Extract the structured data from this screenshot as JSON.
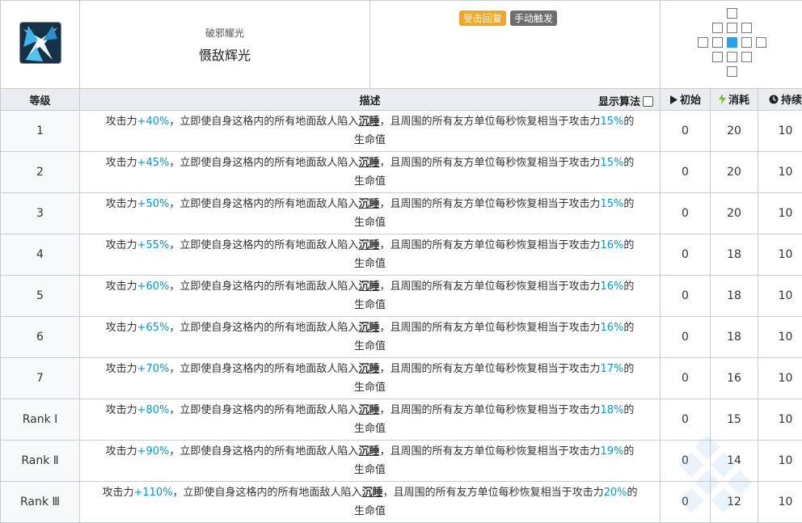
{
  "skill": {
    "sub_name": "破邪耀光",
    "name": "慑敌辉光",
    "tags": [
      "受击回复",
      "手动触发"
    ],
    "tag_colors": {
      "recovery": "#f0a722",
      "trigger": "#6e6e6e"
    },
    "icon": "skill-icon",
    "range_self_color": "#26a2e7"
  },
  "table": {
    "headers": {
      "level": "等级",
      "desc": "描述",
      "show_formula": "显示算法",
      "initial": "初始",
      "cost": "消耗",
      "duration": "持续"
    },
    "desc_parts": {
      "prefix": "攻击力",
      "mid1": "，立即使自身这格内的所有地面敌人陷入",
      "status": "沉睡",
      "mid2": "，且周围的所有友方单位每秒恢复相当于攻击力",
      "end": "的",
      "tail": "生命值"
    },
    "rows": [
      {
        "level": "1",
        "atk": "+40%",
        "heal": "15%",
        "initial": "0",
        "cost": "20",
        "duration": "10"
      },
      {
        "level": "2",
        "atk": "+45%",
        "heal": "15%",
        "initial": "0",
        "cost": "20",
        "duration": "10"
      },
      {
        "level": "3",
        "atk": "+50%",
        "heal": "15%",
        "initial": "0",
        "cost": "20",
        "duration": "10"
      },
      {
        "level": "4",
        "atk": "+55%",
        "heal": "16%",
        "initial": "0",
        "cost": "18",
        "duration": "10"
      },
      {
        "level": "5",
        "atk": "+60%",
        "heal": "16%",
        "initial": "0",
        "cost": "18",
        "duration": "10"
      },
      {
        "level": "6",
        "atk": "+65%",
        "heal": "16%",
        "initial": "0",
        "cost": "18",
        "duration": "10"
      },
      {
        "level": "7",
        "atk": "+70%",
        "heal": "17%",
        "initial": "0",
        "cost": "16",
        "duration": "10"
      },
      {
        "level": "Rank Ⅰ",
        "atk": "+80%",
        "heal": "18%",
        "initial": "0",
        "cost": "15",
        "duration": "10"
      },
      {
        "level": "Rank Ⅱ",
        "atk": "+90%",
        "heal": "19%",
        "initial": "0",
        "cost": "14",
        "duration": "10"
      },
      {
        "level": "Rank Ⅲ",
        "atk": "+110%",
        "heal": "20%",
        "initial": "0",
        "cost": "12",
        "duration": "10"
      }
    ]
  }
}
